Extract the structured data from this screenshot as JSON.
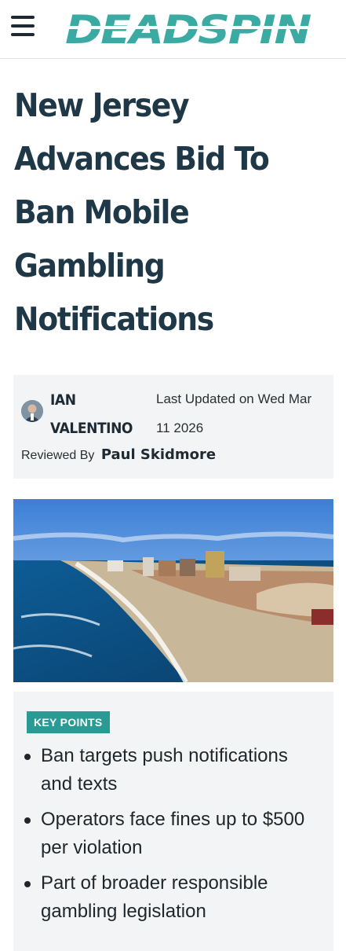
{
  "header": {
    "logo_text": "DEADSPIN",
    "menu_icon": "hamburger-menu-icon",
    "logo_color": "#3aaaa2"
  },
  "article": {
    "headline": "New Jersey Advances Bid To Ban Mobile Gambling Notifications",
    "author": "IAN VALENTINO",
    "last_updated": "Last Updated on Wed Mar 11 2026",
    "reviewed_by_label": "Reviewed By",
    "reviewer": "Paul Skidmore",
    "hero_image": "Aerial view of Atlantic City beach and skyline"
  },
  "key_points": {
    "badge": "KEY POINTS",
    "items": [
      "Ban targets push notifications and texts",
      "Operators face fines up to $500 per violation",
      "Part of broader responsible gambling legislation"
    ]
  },
  "colors": {
    "accent": "#2b9a93",
    "headline": "#1f3847",
    "panel": "#f3f4f5"
  }
}
